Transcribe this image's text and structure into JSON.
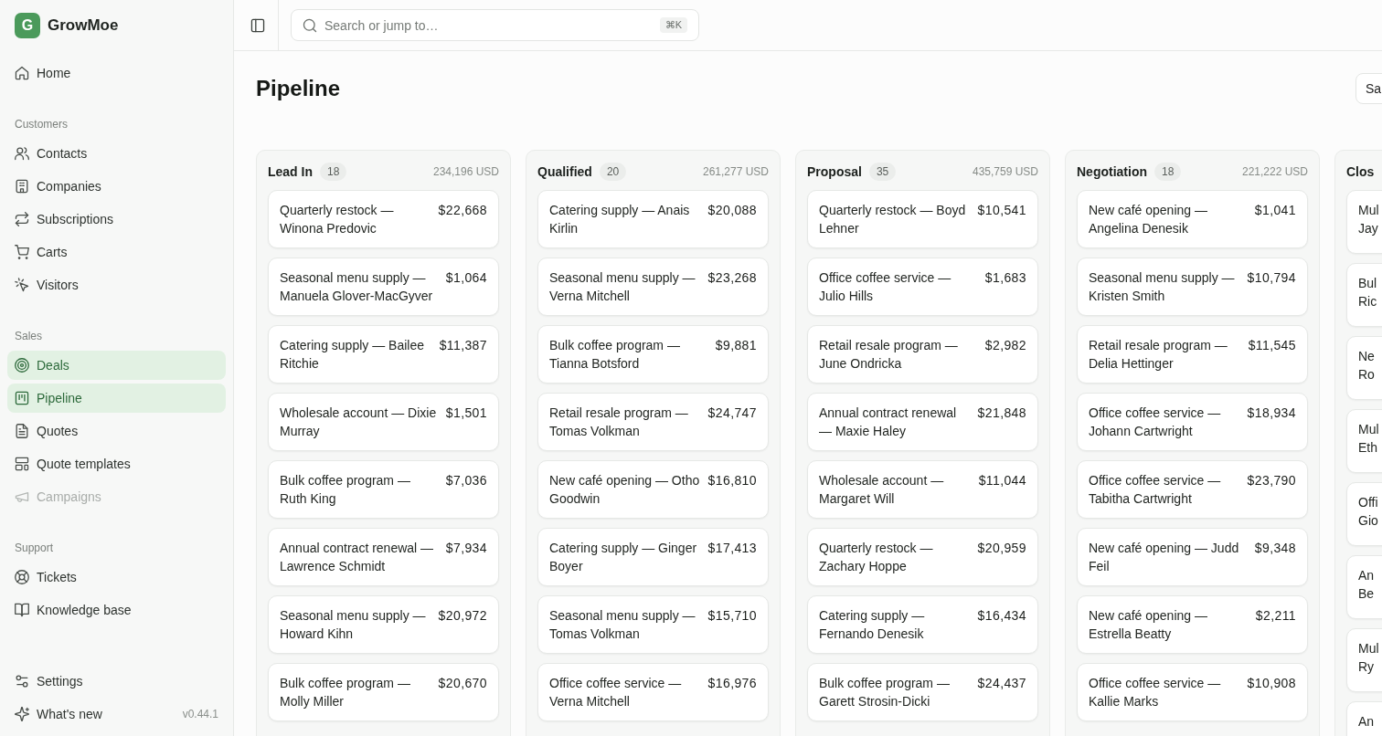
{
  "sidebar": {
    "brand": {
      "letter": "G",
      "name": "GrowMoe"
    },
    "sections": [
      {
        "items": [
          {
            "label": "Home",
            "selected": false,
            "disabled": false
          }
        ]
      },
      {
        "heading": "Customers",
        "items": [
          {
            "label": "Contacts",
            "selected": false,
            "disabled": false
          },
          {
            "label": "Companies",
            "selected": false,
            "disabled": false
          },
          {
            "label": "Subscriptions",
            "selected": false,
            "disabled": false
          },
          {
            "label": "Carts",
            "selected": false,
            "disabled": false
          },
          {
            "label": "Visitors",
            "selected": false,
            "disabled": false
          }
        ]
      },
      {
        "heading": "Sales",
        "items": [
          {
            "label": "Deals",
            "selected": true,
            "disabled": false
          },
          {
            "label": "Pipeline",
            "selected": true,
            "disabled": false
          },
          {
            "label": "Quotes",
            "selected": false,
            "disabled": false
          },
          {
            "label": "Quote templates",
            "selected": false,
            "disabled": false
          },
          {
            "label": "Campaigns",
            "selected": false,
            "disabled": true
          }
        ]
      },
      {
        "heading": "Support",
        "items": [
          {
            "label": "Tickets",
            "selected": false,
            "disabled": false
          },
          {
            "label": "Knowledge base",
            "selected": false,
            "disabled": false
          }
        ]
      }
    ],
    "footer": [
      {
        "label": "Settings",
        "selected": false
      },
      {
        "label": "What's new",
        "selected": false,
        "version": "v0.44.1"
      }
    ]
  },
  "topbar": {
    "search": {
      "placeholder": "Search or jump to…",
      "shortcut": "⌘K"
    }
  },
  "page": {
    "title": "Pipeline",
    "action": "Sa"
  },
  "board": {
    "columns": [
      {
        "name": "Lead In",
        "count": "18",
        "total": "234,196 USD",
        "cards": [
          {
            "title": "Quarterly restock — Winona Predovic",
            "amount": "$22,668"
          },
          {
            "title": "Seasonal menu supply — Manuela Glover-MacGyver",
            "amount": "$1,064"
          },
          {
            "title": "Catering supply — Bailee Ritchie",
            "amount": "$11,387"
          },
          {
            "title": "Wholesale account — Dixie Murray",
            "amount": "$1,501"
          },
          {
            "title": "Bulk coffee program — Ruth King",
            "amount": "$7,036"
          },
          {
            "title": "Annual contract renewal — Lawrence Schmidt",
            "amount": "$7,934"
          },
          {
            "title": "Seasonal menu supply — Howard Kihn",
            "amount": "$20,972"
          },
          {
            "title": "Bulk coffee program — Molly Miller",
            "amount": "$20,670"
          }
        ]
      },
      {
        "name": "Qualified",
        "count": "20",
        "total": "261,277 USD",
        "cards": [
          {
            "title": "Catering supply — Anais Kirlin",
            "amount": "$20,088"
          },
          {
            "title": "Seasonal menu supply — Verna Mitchell",
            "amount": "$23,268"
          },
          {
            "title": "Bulk coffee program — Tianna Botsford",
            "amount": "$9,881"
          },
          {
            "title": "Retail resale program — Tomas Volkman",
            "amount": "$24,747"
          },
          {
            "title": "New café opening — Otho Goodwin",
            "amount": "$16,810"
          },
          {
            "title": "Catering supply — Ginger Boyer",
            "amount": "$17,413"
          },
          {
            "title": "Seasonal menu supply — Tomas Volkman",
            "amount": "$15,710"
          },
          {
            "title": "Office coffee service — Verna Mitchell",
            "amount": "$16,976"
          }
        ]
      },
      {
        "name": "Proposal",
        "count": "35",
        "total": "435,759 USD",
        "cards": [
          {
            "title": "Quarterly restock — Boyd Lehner",
            "amount": "$10,541"
          },
          {
            "title": "Office coffee service — Julio Hills",
            "amount": "$1,683"
          },
          {
            "title": "Retail resale program — June Ondricka",
            "amount": "$2,982"
          },
          {
            "title": "Annual contract renewal — Maxie Haley",
            "amount": "$21,848"
          },
          {
            "title": "Wholesale account — Margaret Will",
            "amount": "$11,044"
          },
          {
            "title": "Quarterly restock — Zachary Hoppe",
            "amount": "$20,959"
          },
          {
            "title": "Catering supply — Fernando Denesik",
            "amount": "$16,434"
          },
          {
            "title": "Bulk coffee program — Garett Strosin-Dicki",
            "amount": "$24,437"
          }
        ]
      },
      {
        "name": "Negotiation",
        "count": "18",
        "total": "221,222 USD",
        "cards": [
          {
            "title": "New café opening — Angelina Denesik",
            "amount": "$1,041"
          },
          {
            "title": "Seasonal menu supply — Kristen Smith",
            "amount": "$10,794"
          },
          {
            "title": "Retail resale program — Delia Hettinger",
            "amount": "$11,545"
          },
          {
            "title": "Office coffee service — Johann Cartwright",
            "amount": "$18,934"
          },
          {
            "title": "Office coffee service — Tabitha Cartwright",
            "amount": "$23,790"
          },
          {
            "title": "New café opening — Judd Feil",
            "amount": "$9,348"
          },
          {
            "title": "New café opening — Estrella Beatty",
            "amount": "$2,211"
          },
          {
            "title": "Office coffee service — Kallie Marks",
            "amount": "$10,908"
          }
        ]
      },
      {
        "name": "Clos",
        "cards": [
          {
            "title": "Mul\nJay"
          },
          {
            "title": "Bul\nRic"
          },
          {
            "title": "Ne\nRo"
          },
          {
            "title": "Mul\nEth"
          },
          {
            "title": "Offi\nGio"
          },
          {
            "title": "An\nBe"
          },
          {
            "title": "Mul\nRy"
          },
          {
            "title": "An"
          }
        ]
      }
    ]
  }
}
